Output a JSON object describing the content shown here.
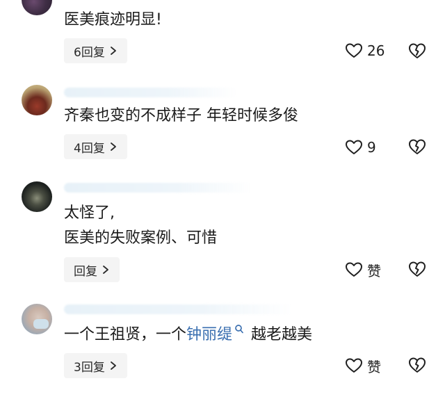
{
  "comments": [
    {
      "text": "医美痕迹明显!",
      "reply_label": "6回复",
      "like_count": "26"
    },
    {
      "text": "齐秦也变的不成样子 年轻时候多俊",
      "reply_label": "4回复",
      "like_count": "9"
    },
    {
      "line1": "太怪了,",
      "line2": "医美的失败案例、可惜",
      "reply_label": "回复",
      "like_count": "赞"
    },
    {
      "text_before": "一个王祖贤，一个",
      "link_text": "钟丽缇",
      "text_after": "越老越美",
      "reply_label": "3回复",
      "like_count": "赞"
    }
  ],
  "icons": {
    "like": "heart-outline-icon",
    "dislike": "broken-heart-icon",
    "reply_chevron": "chevron-right-icon",
    "link_search": "search-icon"
  }
}
